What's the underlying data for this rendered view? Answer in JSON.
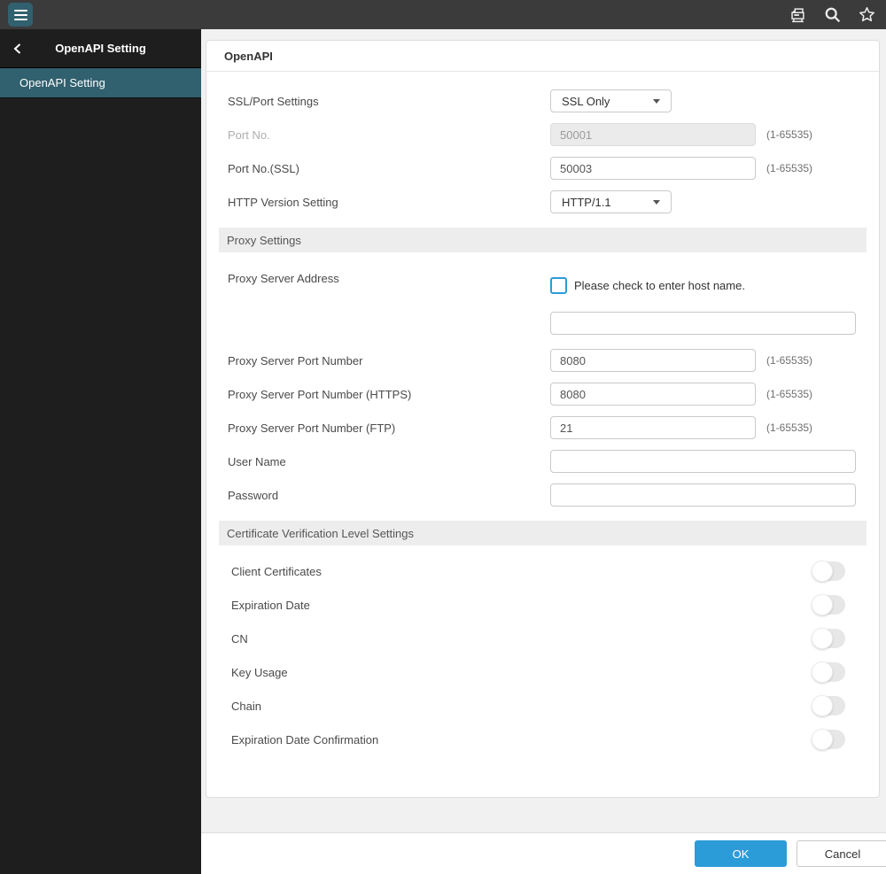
{
  "colors": {
    "accent_teal": "#31606E",
    "topbar_bg": "#3B3B3B",
    "sidebar_bg": "#1E1E1E",
    "primary_blue": "#2B9CD8",
    "section_bar_bg": "#EDEDED",
    "page_bg": "#F1F1F1"
  },
  "topbar": {
    "icons": [
      "menu",
      "device",
      "search",
      "favorite-star"
    ]
  },
  "sidebar": {
    "back_chevron": "‹",
    "title": "OpenAPI Setting",
    "items": [
      {
        "label": "OpenAPI Setting",
        "selected": true
      }
    ]
  },
  "panel": {
    "title": "OpenAPI",
    "sections": {
      "proxy": "Proxy Settings",
      "certificate": "Certificate Verification Level Settings"
    },
    "fields": {
      "ssl_port": {
        "label": "SSL/Port Settings",
        "value": "SSL Only"
      },
      "port": {
        "label": "Port No.",
        "value": "50001",
        "hint": "(1-65535)",
        "disabled": true
      },
      "port_ssl": {
        "label": "Port No.(SSL)",
        "value": "50003",
        "hint": "(1-65535)"
      },
      "http_version": {
        "label": "HTTP Version Setting",
        "value": "HTTP/1.1"
      },
      "proxy_address": {
        "label": "Proxy Server Address",
        "checkbox_label": "Please check to enter host name.",
        "checked": false,
        "value": ""
      },
      "proxy_port": {
        "label": "Proxy Server Port Number",
        "value": "8080",
        "hint": "(1-65535)"
      },
      "proxy_port_https": {
        "label": "Proxy Server Port Number (HTTPS)",
        "value": "8080",
        "hint": "(1-65535)"
      },
      "proxy_port_ftp": {
        "label": "Proxy Server Port Number (FTP)",
        "value": "21",
        "hint": "(1-65535)"
      },
      "user_name": {
        "label": "User Name",
        "value": ""
      },
      "password": {
        "label": "Password",
        "value": ""
      }
    },
    "toggles": [
      {
        "label": "Client Certificates",
        "on": false
      },
      {
        "label": "Expiration Date",
        "on": false
      },
      {
        "label": "CN",
        "on": false
      },
      {
        "label": "Key Usage",
        "on": false
      },
      {
        "label": "Chain",
        "on": false
      },
      {
        "label": "Expiration Date Confirmation",
        "on": false
      }
    ]
  },
  "footer": {
    "ok_label": "OK",
    "cancel_label": "Cancel"
  }
}
